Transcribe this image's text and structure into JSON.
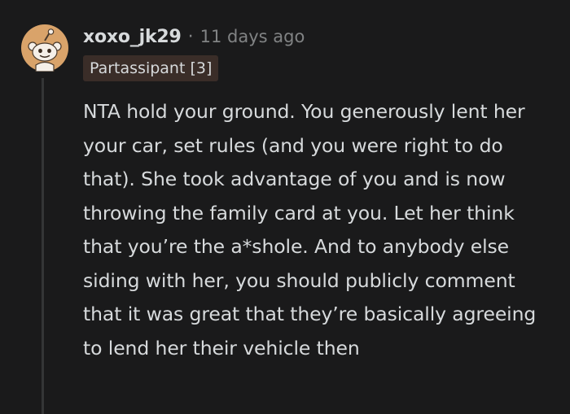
{
  "comment": {
    "author": "xoxo_jk29",
    "separator": "·",
    "timestamp": "11 days ago",
    "flair": "Partassipant [3]",
    "avatar_icon": "snoo-avatar-icon",
    "body": "NTA hold your ground. You generously lent her your car, set rules (and you were right to do that). She took advantage of you and is now throwing the family card at you. Let her think that you’re the a*shole. And to anybody else siding with her, you should publicly comment that it was great that they’re basically agreeing to lend her their vehicle then"
  },
  "colors": {
    "background": "#1a1a1b",
    "text": "#d7dadc",
    "muted": "#818384",
    "flair_bg": "#3a2d28",
    "avatar_bg": "#d9a36a",
    "thread_line": "#343536"
  }
}
